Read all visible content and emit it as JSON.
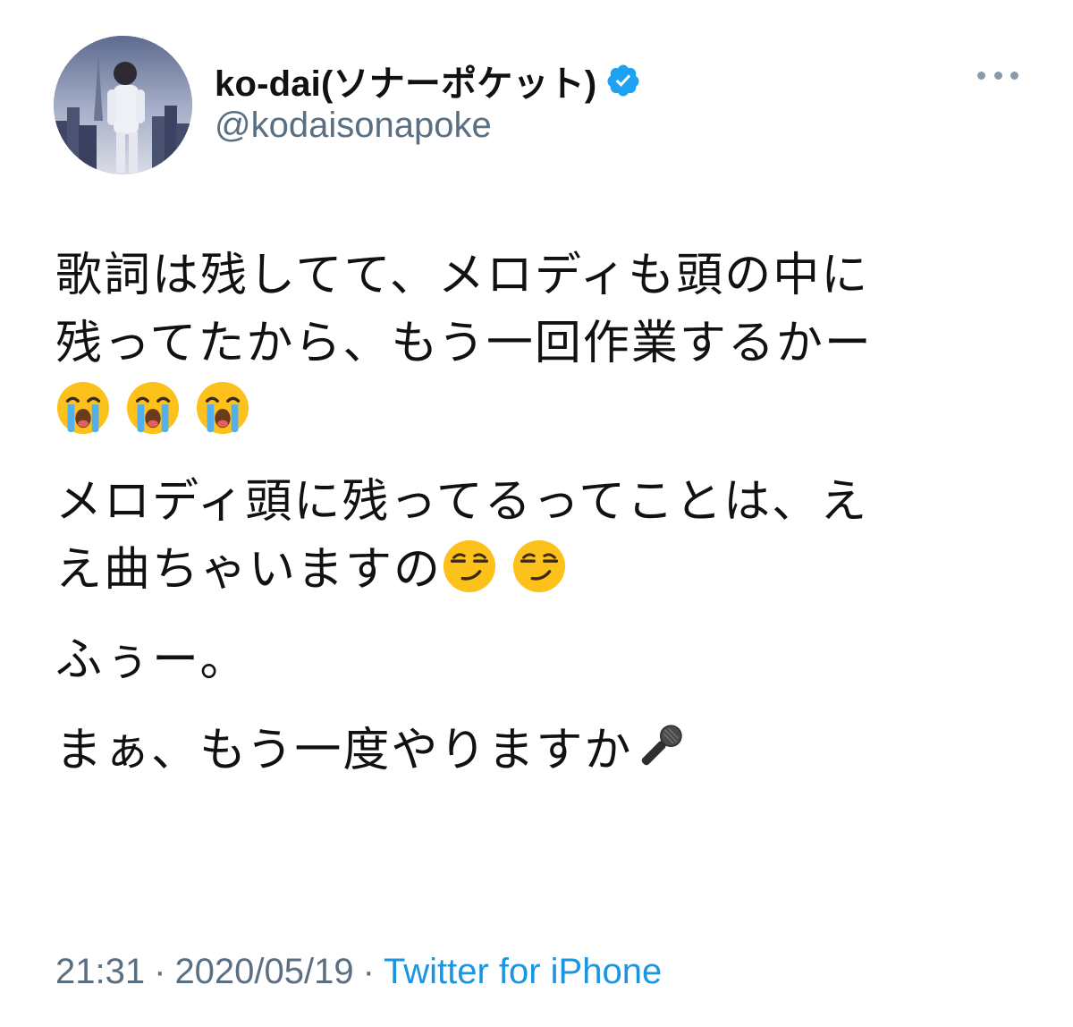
{
  "author": {
    "display_name": "ko-dai(ソナーポケット)",
    "handle": "@kodaisonapoke",
    "verified": true,
    "avatar_icon": "profile-photo"
  },
  "tweet": {
    "paragraphs": [
      {
        "lines": [
          "歌詞は残してて、メロディも頭の中に",
          "残ってたから、もう一回作業するかー"
        ],
        "trailing_emojis": [
          "loudly-crying-face",
          "loudly-crying-face",
          "loudly-crying-face"
        ]
      },
      {
        "lines": [
          "メロディ頭に残ってるってことは、え",
          "え曲ちゃいますの"
        ],
        "trailing_emojis": [
          "smirking-face",
          "smirking-face"
        ]
      },
      {
        "lines": [
          "ふぅー。"
        ],
        "trailing_emojis": []
      },
      {
        "lines": [
          "まぁ、もう一度やりますか"
        ],
        "trailing_emojis": [
          "microphone"
        ]
      }
    ]
  },
  "footer": {
    "time": "21:31",
    "date": "2020/05/19",
    "separator": "·",
    "source": "Twitter for iPhone"
  },
  "colors": {
    "text": "#111111",
    "secondary": "#5b6f82",
    "link": "#1b95e0",
    "verified_badge": "#1da1f2"
  }
}
